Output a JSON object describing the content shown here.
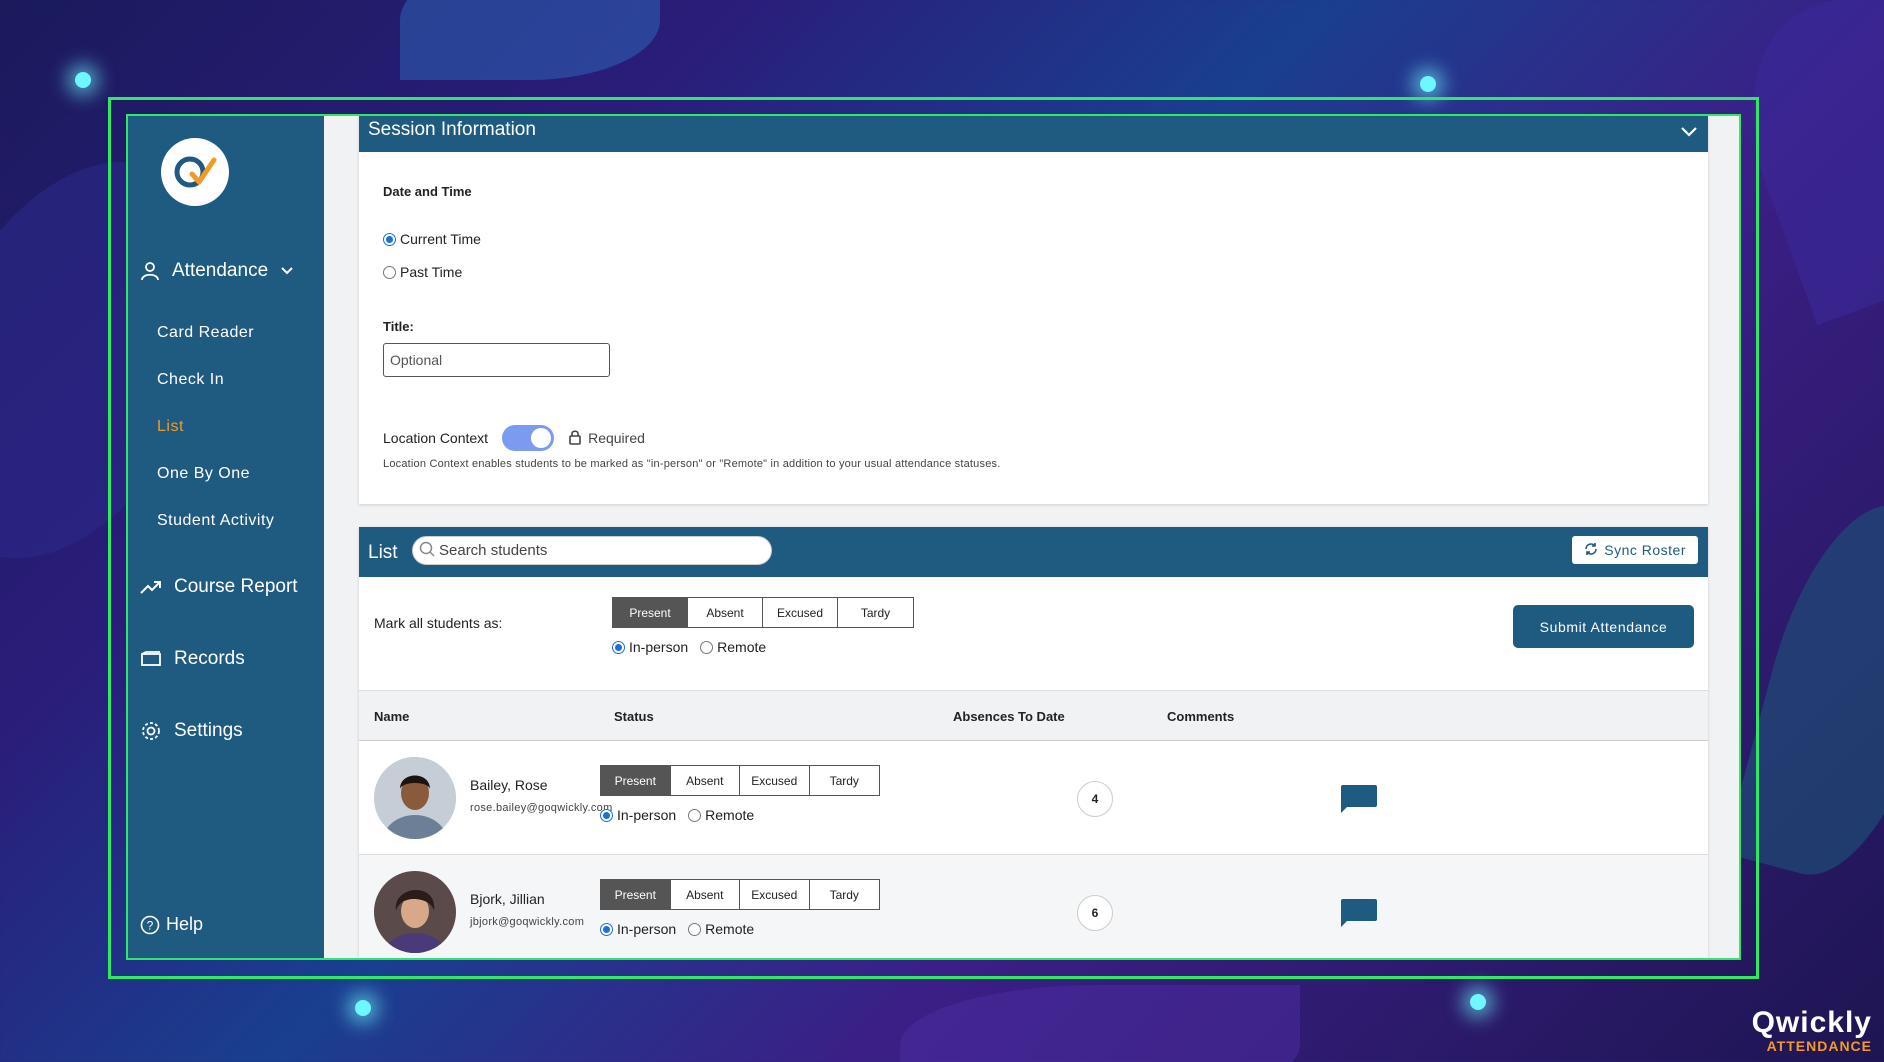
{
  "brand": {
    "name": "Qwickly",
    "sub": "ATTENDANCE"
  },
  "sidebar": {
    "attendance": "Attendance",
    "subitems": [
      "Card Reader",
      "Check In",
      "List",
      "One By One",
      "Student Activity"
    ],
    "active": "List",
    "course_report": "Course Report",
    "records": "Records",
    "settings": "Settings",
    "help": "Help"
  },
  "session": {
    "header": "Session Information",
    "date_time_label": "Date and Time",
    "current_time": "Current Time",
    "past_time": "Past Time",
    "selected": "Current Time",
    "title_label": "Title:",
    "title_placeholder": "Optional",
    "location_label": "Location Context",
    "location_enabled": true,
    "required": "Required",
    "location_desc": "Location Context enables students to be marked as \"in-person\" or \"Remote\" in addition to your usual attendance statuses."
  },
  "list": {
    "title": "List",
    "search_placeholder": "Search students",
    "sync": "Sync Roster",
    "mark_all": "Mark all students as:",
    "statuses": [
      "Present",
      "Absent",
      "Excused",
      "Tardy"
    ],
    "in_person": "In-person",
    "remote": "Remote",
    "submit": "Submit Attendance",
    "columns": {
      "name": "Name",
      "status": "Status",
      "absences": "Absences To Date",
      "comments": "Comments"
    },
    "students": [
      {
        "name": "Bailey, Rose",
        "email": "rose.bailey@goqwickly.com",
        "status": "Present",
        "mode": "In-person",
        "absences": "4"
      },
      {
        "name": "Bjork, Jillian",
        "email": "jbjork@goqwickly.com",
        "status": "Present",
        "mode": "In-person",
        "absences": "6"
      }
    ]
  },
  "colors": {
    "primary": "#1f5a80",
    "accent": "#f39a26",
    "frame": "#2ee866",
    "toggle": "#7a9bf0"
  }
}
